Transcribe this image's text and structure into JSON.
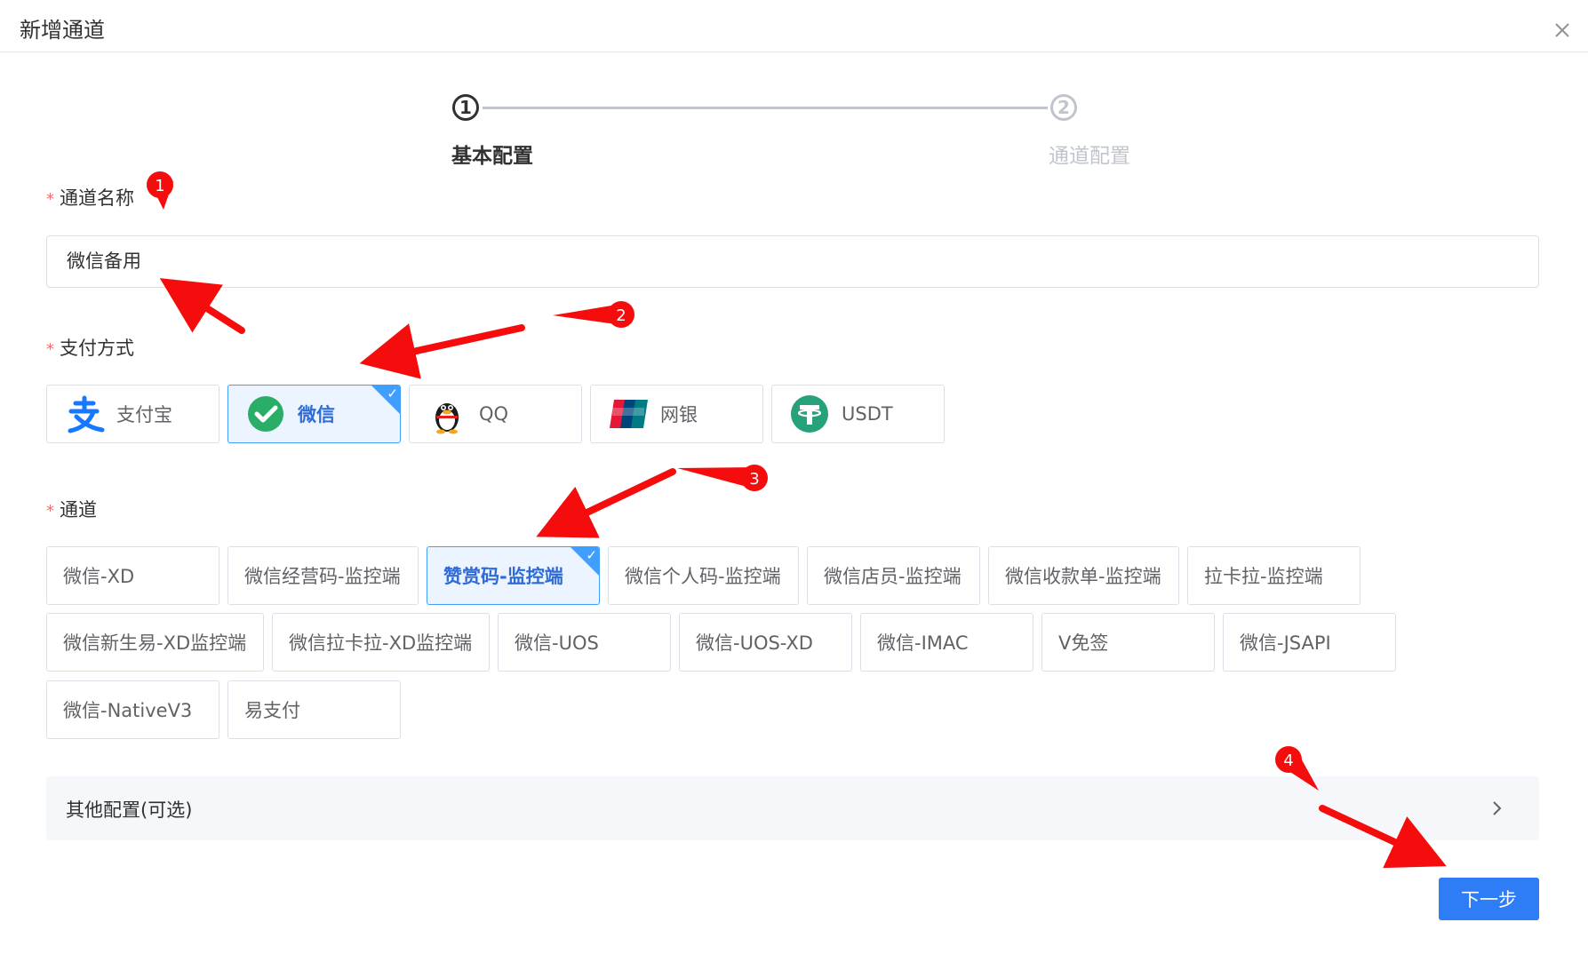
{
  "dialog": {
    "title": "新增通道"
  },
  "steps": [
    {
      "number": "1",
      "title": "基本配置"
    },
    {
      "number": "2",
      "title": "通道配置"
    }
  ],
  "form": {
    "required_mark": "*",
    "channel_name_label": "通道名称",
    "channel_name_value": "微信备用",
    "payment_method_label": "支付方式",
    "channel_label": "通道"
  },
  "payment_methods": [
    {
      "label": "支付宝",
      "icon": "alipay-icon",
      "selected": false
    },
    {
      "label": "微信",
      "icon": "wechat-icon",
      "selected": true
    },
    {
      "label": "QQ",
      "icon": "qq-penguin-icon",
      "selected": false
    },
    {
      "label": "网银",
      "icon": "unionpay-icon",
      "selected": false
    },
    {
      "label": "USDT",
      "icon": "tether-icon",
      "selected": false
    }
  ],
  "channels": [
    {
      "label": "微信-XD",
      "selected": false
    },
    {
      "label": "微信经营码-监控端",
      "selected": false
    },
    {
      "label": "赞赏码-监控端",
      "selected": true
    },
    {
      "label": "微信个人码-监控端",
      "selected": false
    },
    {
      "label": "微信店员-监控端",
      "selected": false
    },
    {
      "label": "微信收款单-监控端",
      "selected": false
    },
    {
      "label": "拉卡拉-监控端",
      "selected": false
    },
    {
      "label": "微信新生易-XD监控端",
      "selected": false
    },
    {
      "label": "微信拉卡拉-XD监控端",
      "selected": false
    },
    {
      "label": "微信-UOS",
      "selected": false
    },
    {
      "label": "微信-UOS-XD",
      "selected": false
    },
    {
      "label": "微信-IMAC",
      "selected": false
    },
    {
      "label": "V免签",
      "selected": false
    },
    {
      "label": "微信-JSAPI",
      "selected": false
    },
    {
      "label": "微信-NativeV3",
      "selected": false
    },
    {
      "label": "易支付",
      "selected": false
    }
  ],
  "other_config": {
    "label": "其他配置(可选)"
  },
  "next_button": {
    "label": "下一步"
  },
  "annotations": [
    "1",
    "2",
    "3",
    "4"
  ],
  "colors": {
    "primary": "#409eff",
    "button": "#2f7df6",
    "required": "#f56c6c",
    "annotation": "#f50d0d"
  }
}
